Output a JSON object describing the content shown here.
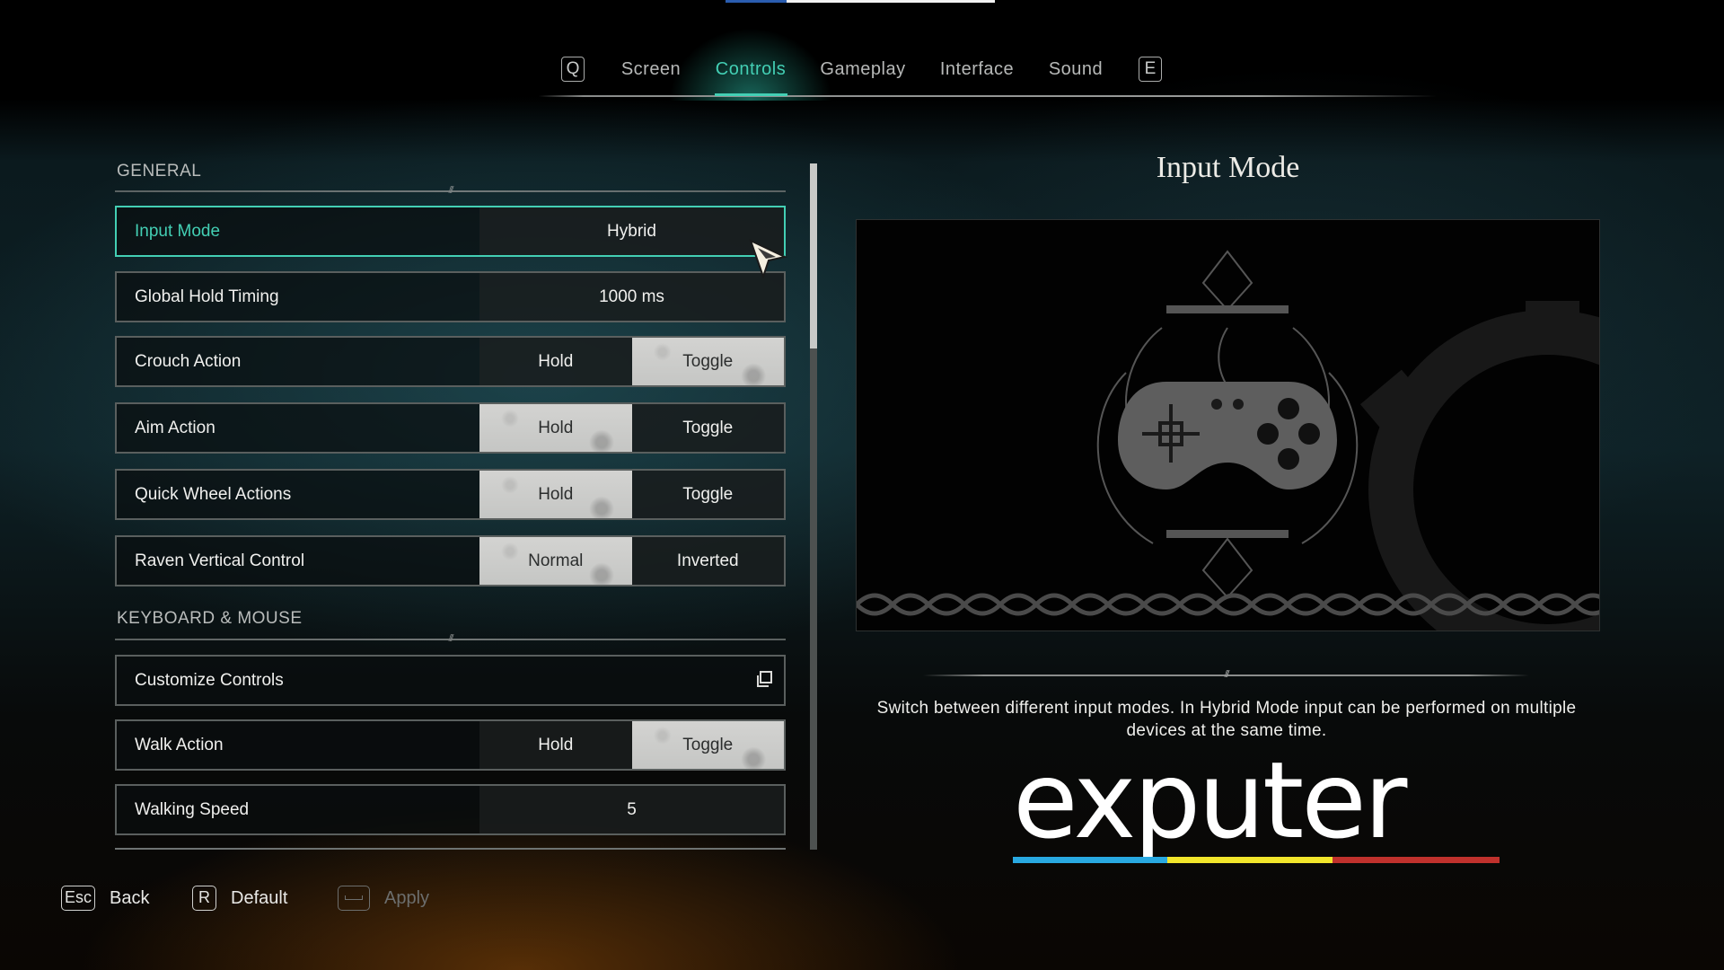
{
  "tabs": {
    "prev_key": "Q",
    "next_key": "E",
    "items": [
      {
        "label": "Screen",
        "active": false
      },
      {
        "label": "Controls",
        "active": true
      },
      {
        "label": "Gameplay",
        "active": false
      },
      {
        "label": "Interface",
        "active": false
      },
      {
        "label": "Sound",
        "active": false
      }
    ]
  },
  "colors": {
    "accent": "#43cfb4",
    "selected_option_bg": "#cfcfcd",
    "selected_option_text": "#2b2d2d"
  },
  "sections": [
    {
      "heading": "GENERAL",
      "settings": [
        {
          "label": "Input Mode",
          "type": "value",
          "value": "Hybrid",
          "focused": true
        },
        {
          "label": "Global Hold Timing",
          "type": "value",
          "value": "1000 ms"
        },
        {
          "label": "Crouch Action",
          "type": "toggle",
          "options": [
            "Hold",
            "Toggle"
          ],
          "selected": "Toggle"
        },
        {
          "label": "Aim Action",
          "type": "toggle",
          "options": [
            "Hold",
            "Toggle"
          ],
          "selected": "Hold"
        },
        {
          "label": "Quick Wheel Actions",
          "type": "toggle",
          "options": [
            "Hold",
            "Toggle"
          ],
          "selected": "Hold"
        },
        {
          "label": "Raven Vertical Control",
          "type": "toggle",
          "options": [
            "Normal",
            "Inverted"
          ],
          "selected": "Normal"
        }
      ]
    },
    {
      "heading": "KEYBOARD & MOUSE",
      "settings": [
        {
          "label": "Customize Controls",
          "type": "link",
          "icon": "external-window-icon"
        },
        {
          "label": "Walk Action",
          "type": "toggle",
          "options": [
            "Hold",
            "Toggle"
          ],
          "selected": "Toggle"
        },
        {
          "label": "Walking Speed",
          "type": "value",
          "value": "5"
        }
      ]
    }
  ],
  "scrollbar": {
    "position_fraction": 0.0,
    "visible_fraction": 0.27
  },
  "info_panel": {
    "title": "Input Mode",
    "image_icon": "gamepad-icon",
    "description": "Switch between different input modes. In Hybrid Mode input can be performed on multiple devices at the same time."
  },
  "footer": {
    "back": {
      "key": "Esc",
      "label": "Back"
    },
    "default": {
      "key": "R",
      "label": "Default"
    },
    "apply": {
      "key": "space-bar-icon",
      "label": "Apply",
      "enabled": false
    }
  },
  "watermark": {
    "text": "exputer",
    "bar_colors": [
      "#29a9e1",
      "#f2e62b",
      "#c0312c"
    ]
  }
}
